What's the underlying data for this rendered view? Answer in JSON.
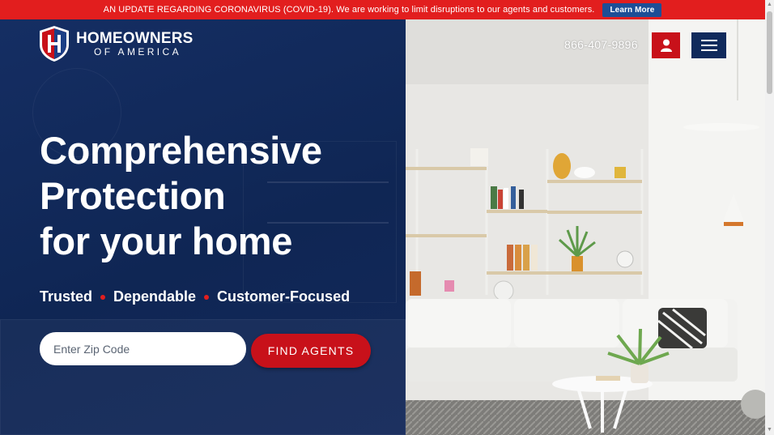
{
  "alert": {
    "message": "AN UPDATE REGARDING CORONAVIRUS (COVID-19). We are working to limit disruptions to our agents and customers.",
    "button_label": "Learn More"
  },
  "logo": {
    "line1": "HOMEOWNERS",
    "line2": "OF AMERICA",
    "shield_letter": "H"
  },
  "header": {
    "phone": "866-407-9896",
    "user_icon": "user-icon",
    "menu_icon": "hamburger-menu-icon"
  },
  "hero": {
    "title_lines": [
      "Comprehensive",
      "Protection",
      "for your home"
    ],
    "features": [
      "Trusted",
      "Dependable",
      "Customer-Focused"
    ]
  },
  "search": {
    "placeholder": "Enter Zip Code",
    "value": "",
    "button_label": "FIND AGENTS"
  },
  "colors": {
    "brand_red": "#c8111a",
    "alert_red": "#e21e1e",
    "navy": "#0f2650",
    "learn_more_blue": "#1d4e96"
  }
}
